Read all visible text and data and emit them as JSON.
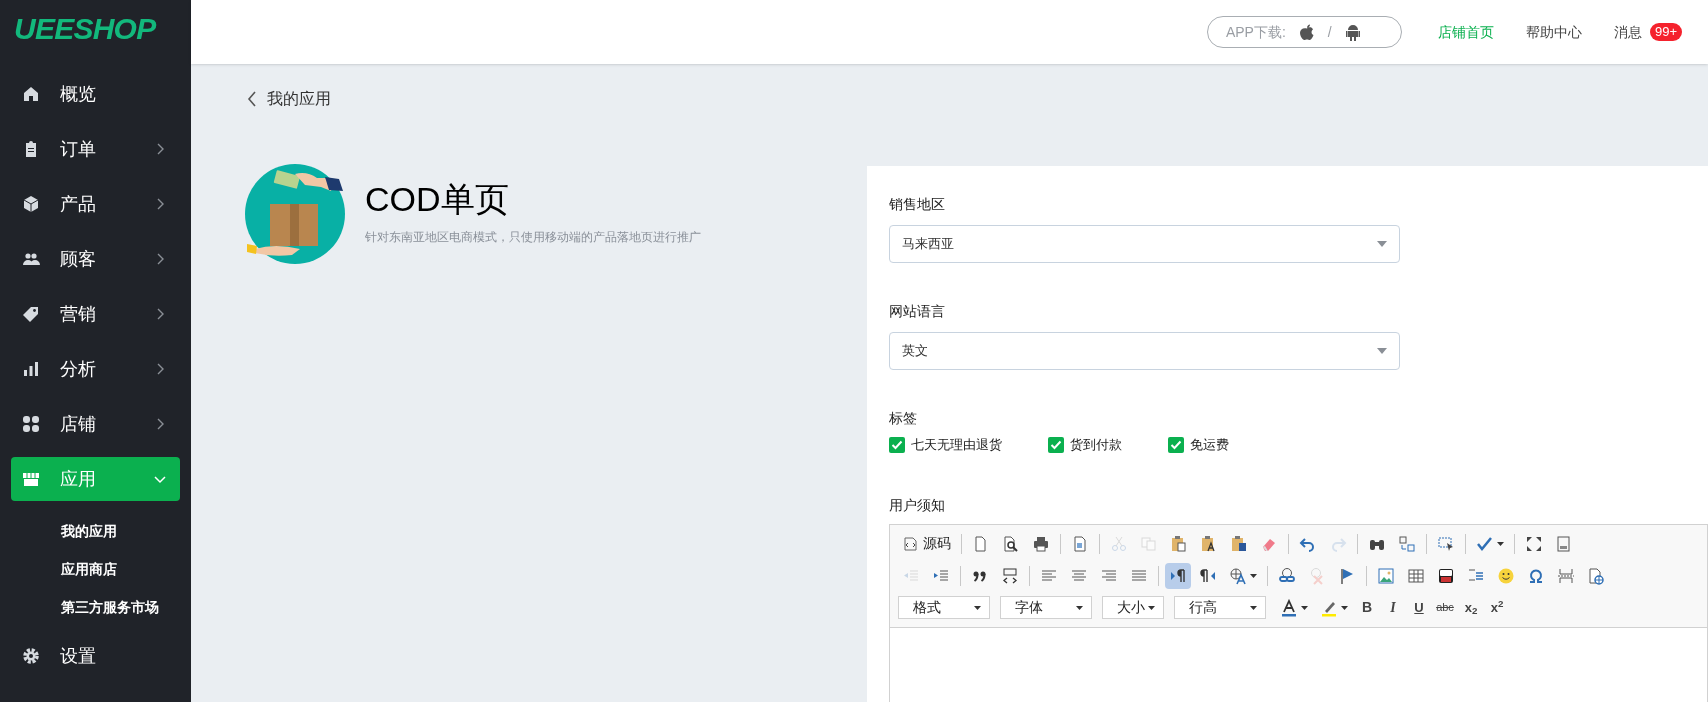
{
  "logo": {
    "text": "UEESHOP"
  },
  "sidebar": {
    "items": [
      {
        "label": "概览",
        "selected": false
      },
      {
        "label": "订单",
        "expanded": false,
        "selected": false
      },
      {
        "label": "产品",
        "expanded": false,
        "selected": false
      },
      {
        "label": "顾客",
        "expanded": false,
        "selected": false
      },
      {
        "label": "营销",
        "expanded": false,
        "selected": false
      },
      {
        "label": "分析",
        "expanded": false,
        "selected": false
      },
      {
        "label": "店铺",
        "expanded": false,
        "selected": false
      },
      {
        "label": "应用",
        "expanded": true,
        "selected": true,
        "children": [
          {
            "label": "我的应用"
          },
          {
            "label": "应用商店"
          },
          {
            "label": "第三方服务市场"
          }
        ]
      },
      {
        "label": "设置",
        "selected": false
      }
    ]
  },
  "header": {
    "app_download": {
      "label": "APP下载:",
      "separator": "/"
    },
    "links": [
      {
        "label": "店铺首页",
        "selected": true
      },
      {
        "label": "帮助中心",
        "selected": false
      },
      {
        "label": "消息",
        "selected": false,
        "badge": "99+"
      }
    ]
  },
  "breadcrumb": {
    "back_label": "我的应用"
  },
  "app": {
    "title": "COD单页",
    "description": "针对东南亚地区电商模式，只使用移动端的产品落地页进行推广"
  },
  "form": {
    "fields": [
      {
        "label": "销售地区",
        "value": "马来西亚"
      },
      {
        "label": "网站语言",
        "value": "英文"
      }
    ],
    "tags": {
      "label": "标签",
      "options": [
        {
          "label": "七天无理由退货",
          "checked": true
        },
        {
          "label": "货到付款",
          "checked": true
        },
        {
          "label": "免运费",
          "checked": true
        }
      ]
    },
    "notice": {
      "label": "用户须知"
    }
  },
  "editor": {
    "toolbar_rows": [
      [
        {
          "kind": "text",
          "label": "源码",
          "disabled": false,
          "selected": false
        },
        {
          "kind": "sep"
        },
        {
          "kind": "icon",
          "disabled": false,
          "selected": false
        },
        {
          "kind": "icon",
          "disabled": false,
          "selected": false
        },
        {
          "kind": "icon",
          "disabled": false,
          "selected": false
        },
        {
          "kind": "sep"
        },
        {
          "kind": "icon",
          "disabled": false,
          "selected": false
        },
        {
          "kind": "sep"
        },
        {
          "kind": "icon",
          "disabled": true,
          "selected": false
        },
        {
          "kind": "icon",
          "disabled": true,
          "selected": false
        },
        {
          "kind": "icon",
          "disabled": false,
          "selected": false
        },
        {
          "kind": "icon",
          "disabled": false,
          "selected": false
        },
        {
          "kind": "icon",
          "disabled": false,
          "selected": false
        },
        {
          "kind": "icon",
          "disabled": false,
          "selected": false
        },
        {
          "kind": "sep"
        },
        {
          "kind": "icon",
          "disabled": false,
          "selected": false
        },
        {
          "kind": "icon",
          "disabled": true,
          "selected": false
        },
        {
          "kind": "sep"
        },
        {
          "kind": "icon",
          "disabled": false,
          "selected": false
        },
        {
          "kind": "icon",
          "disabled": false,
          "selected": false
        },
        {
          "kind": "sep"
        },
        {
          "kind": "icon",
          "disabled": false,
          "selected": false
        },
        {
          "kind": "sep"
        },
        {
          "kind": "menu",
          "disabled": false,
          "selected": false
        },
        {
          "kind": "sep"
        },
        {
          "kind": "icon",
          "disabled": false,
          "selected": false
        },
        {
          "kind": "icon",
          "disabled": false,
          "selected": false
        }
      ],
      [
        {
          "kind": "icon",
          "disabled": true,
          "selected": false
        },
        {
          "kind": "icon",
          "disabled": false,
          "selected": false
        },
        {
          "kind": "sep"
        },
        {
          "kind": "icon",
          "disabled": false,
          "selected": false
        },
        {
          "kind": "icon",
          "disabled": false,
          "selected": false
        },
        {
          "kind": "sep"
        },
        {
          "kind": "icon",
          "disabled": false,
          "selected": false
        },
        {
          "kind": "icon",
          "disabled": false,
          "selected": false
        },
        {
          "kind": "icon",
          "disabled": false,
          "selected": false
        },
        {
          "kind": "icon",
          "disabled": false,
          "selected": false
        },
        {
          "kind": "sep"
        },
        {
          "kind": "icon",
          "disabled": false,
          "selected": true
        },
        {
          "kind": "icon",
          "disabled": false,
          "selected": false
        },
        {
          "kind": "menu",
          "disabled": false,
          "selected": false
        },
        {
          "kind": "sep"
        },
        {
          "kind": "icon",
          "disabled": false,
          "selected": false
        },
        {
          "kind": "icon",
          "disabled": true,
          "selected": false
        },
        {
          "kind": "icon",
          "disabled": false,
          "selected": false
        },
        {
          "kind": "sep"
        },
        {
          "kind": "icon",
          "disabled": false,
          "selected": false
        },
        {
          "kind": "icon",
          "disabled": false,
          "selected": false
        },
        {
          "kind": "icon",
          "disabled": false,
          "selected": false
        },
        {
          "kind": "icon",
          "disabled": false,
          "selected": false
        },
        {
          "kind": "icon",
          "disabled": false,
          "selected": false
        },
        {
          "kind": "icon",
          "disabled": false,
          "selected": false
        },
        {
          "kind": "icon",
          "disabled": false,
          "selected": false
        },
        {
          "kind": "icon",
          "disabled": false,
          "selected": false
        }
      ],
      [
        {
          "kind": "dropdown",
          "label": "格式"
        },
        {
          "kind": "dropdown",
          "label": "字体"
        },
        {
          "kind": "dropdown",
          "label": "大小"
        },
        {
          "kind": "dropdown",
          "label": "行高"
        },
        {
          "kind": "menu",
          "disabled": false,
          "selected": false
        },
        {
          "kind": "menu",
          "disabled": false,
          "selected": false
        },
        {
          "kind": "bold",
          "label": "B"
        },
        {
          "kind": "italic",
          "label": "I"
        },
        {
          "kind": "underline",
          "label": "U"
        },
        {
          "kind": "strike",
          "label": "abc"
        },
        {
          "kind": "plain",
          "label": "x$_{2}$"
        },
        {
          "kind": "plain",
          "label": "x$^{2}$"
        }
      ]
    ]
  }
}
